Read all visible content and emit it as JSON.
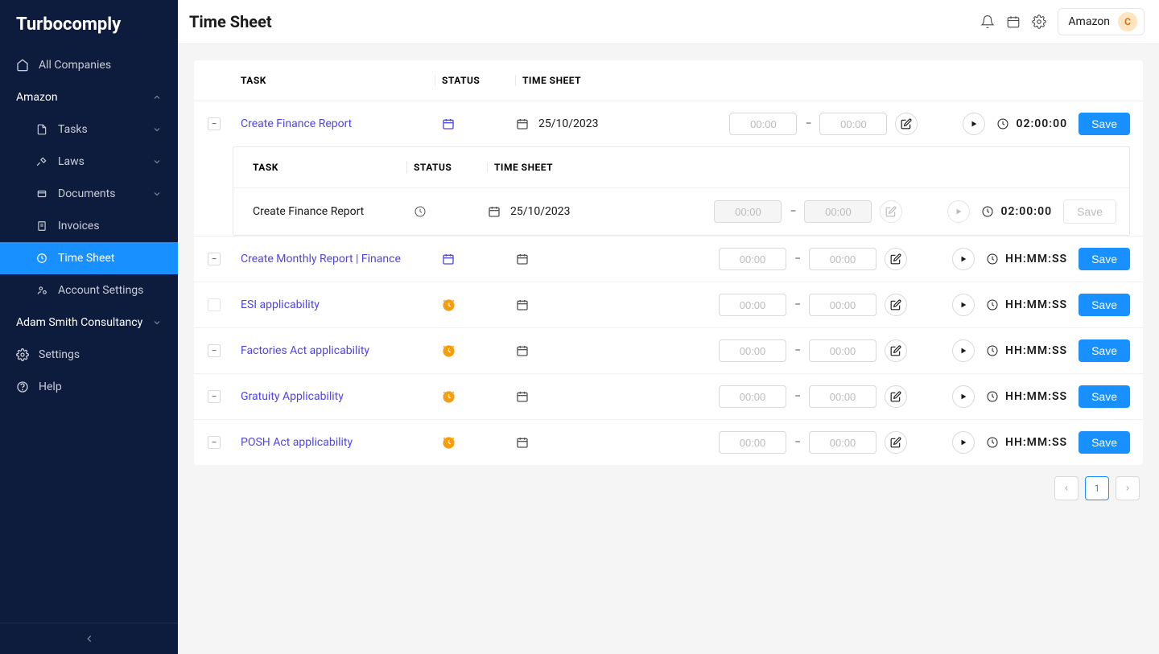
{
  "brand": "Turbocomply",
  "page_title": "Time Sheet",
  "header": {
    "company": "Amazon",
    "avatar_letter": "C"
  },
  "sidebar": {
    "all_companies": "All Companies",
    "companies": [
      {
        "name": "Amazon",
        "expanded": true
      },
      {
        "name": "Adam Smith Consultancy",
        "expanded": false
      }
    ],
    "items": [
      {
        "label": "Tasks",
        "has_chevron": true
      },
      {
        "label": "Laws",
        "has_chevron": true
      },
      {
        "label": "Documents",
        "has_chevron": true
      },
      {
        "label": "Invoices",
        "has_chevron": false
      },
      {
        "label": "Time Sheet",
        "has_chevron": false,
        "active": true
      },
      {
        "label": "Account Settings",
        "has_chevron": false
      }
    ],
    "settings": "Settings",
    "help": "Help"
  },
  "table": {
    "columns": {
      "task": "TASK",
      "status": "STATUS",
      "timesheet": "TIME SHEET"
    },
    "time_placeholder": "00:00",
    "dash": "−",
    "save": "Save",
    "rows": [
      {
        "expander": "−",
        "task": "Create Finance Report",
        "is_link": true,
        "status_type": "cal",
        "date": "25/10/2023",
        "duration": "02:00:00",
        "subrow": {
          "task": "Create Finance Report",
          "status_type": "plain_clock",
          "date": "25/10/2023",
          "duration": "02:00:00",
          "disabled": true
        }
      },
      {
        "expander": "−",
        "task": "Create Monthly Report | Finance",
        "is_link": true,
        "status_type": "cal",
        "date": "",
        "duration": "HH:MM:SS"
      },
      {
        "expander": "□",
        "task": "ESI applicability",
        "is_link": true,
        "status_type": "clock",
        "date": "",
        "duration": "HH:MM:SS"
      },
      {
        "expander": "−",
        "task": "Factories Act applicability",
        "is_link": true,
        "status_type": "clock",
        "date": "",
        "duration": "HH:MM:SS"
      },
      {
        "expander": "−",
        "task": "Gratuity Applicability",
        "is_link": true,
        "status_type": "clock",
        "date": "",
        "duration": "HH:MM:SS"
      },
      {
        "expander": "−",
        "task": "POSH Act applicability",
        "is_link": true,
        "status_type": "clock",
        "date": "",
        "duration": "HH:MM:SS"
      }
    ]
  },
  "pagination": {
    "page": "1"
  }
}
